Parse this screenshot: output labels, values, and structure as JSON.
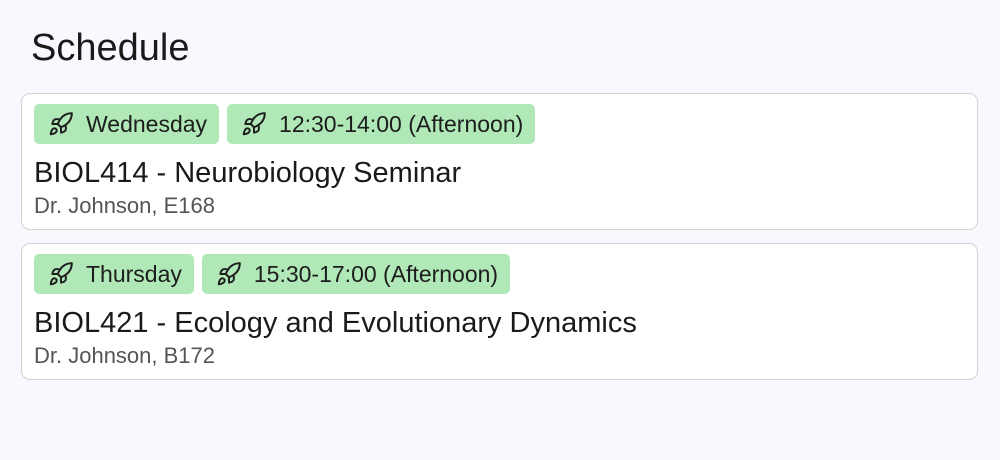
{
  "page": {
    "title": "Schedule"
  },
  "colors": {
    "background": "#f8f9fe",
    "tag_background": "#b1e8b7",
    "card_border": "#d2d2d2"
  },
  "schedule": [
    {
      "day": "Wednesday",
      "time": "12:30-14:00 (Afternoon)",
      "course": "BIOL414 - Neurobiology Seminar",
      "details": "Dr. Johnson, E168",
      "tag_icon": "rocket-icon"
    },
    {
      "day": "Thursday",
      "time": "15:30-17:00 (Afternoon)",
      "course": "BIOL421 - Ecology and Evolutionary Dynamics",
      "details": "Dr. Johnson, B172",
      "tag_icon": "rocket-icon"
    }
  ]
}
